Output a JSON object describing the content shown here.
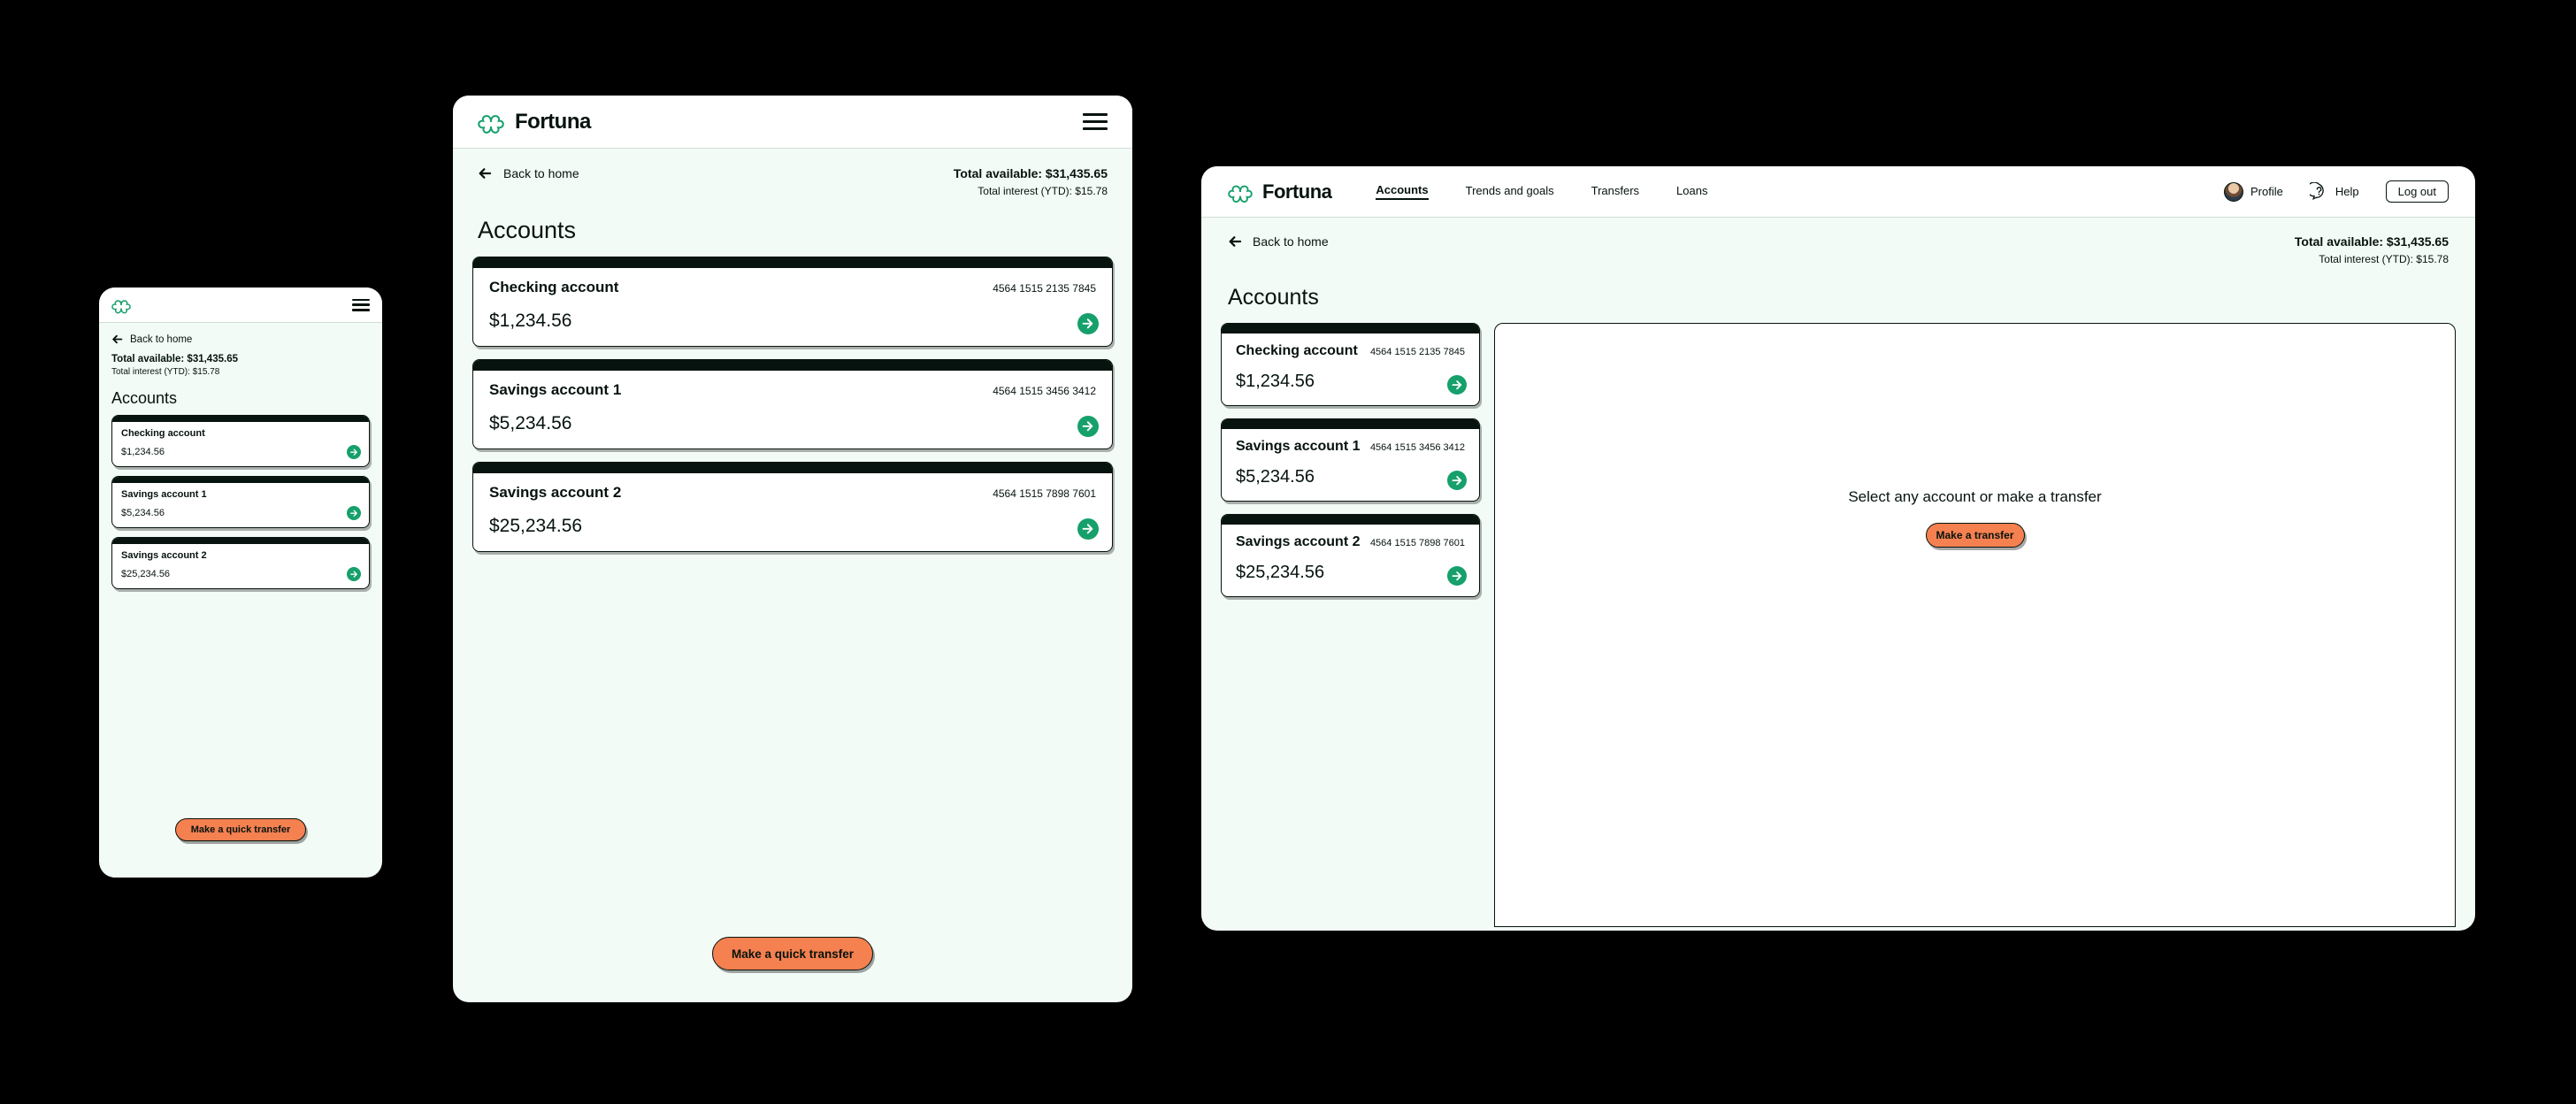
{
  "brand": {
    "name": "Fortuna",
    "logo_icon": "clover-icon",
    "accent_green": "#16a06b",
    "ink": "#06130e",
    "page_bg": "#f2fbf6",
    "cta_orange": "#f58050",
    "canvas": "#000000"
  },
  "header": {
    "menu_icon": "hamburger-icon",
    "nav": [
      {
        "label": "Accounts",
        "active": true
      },
      {
        "label": "Trends and goals",
        "active": false
      },
      {
        "label": "Transfers",
        "active": false
      },
      {
        "label": "Loans",
        "active": false
      }
    ],
    "profile": {
      "label": "Profile",
      "icon": "avatar-icon"
    },
    "help": {
      "label": "Help",
      "icon": "question-mark-icon"
    },
    "logout": {
      "label": "Log out"
    }
  },
  "subheader": {
    "back_icon": "arrow-left-icon",
    "back_label": "Back  to home",
    "total_available": "Total available: $31,435.65",
    "total_interest": "Total interest (YTD):  $15.78"
  },
  "main": {
    "section_title": "Accounts",
    "accounts": [
      {
        "name": "Checking account",
        "number": "4564 1515 2135 7845",
        "balance": "$1,234.56",
        "go_icon": "arrow-right-circle-icon"
      },
      {
        "name": "Savings account 1",
        "number": "4564 1515 3456 3412",
        "balance": "$5,234.56",
        "go_icon": "arrow-right-circle-icon"
      },
      {
        "name": "Savings account 2",
        "number": "4564 1515 7898 7601",
        "balance": "$25,234.56",
        "go_icon": "arrow-right-circle-icon"
      }
    ]
  },
  "detail_panel": {
    "empty_message": "Select any account or make a transfer",
    "cta_label": "Make a transfer"
  },
  "cta": {
    "quick_transfer_label": "Make a quick transfer"
  }
}
